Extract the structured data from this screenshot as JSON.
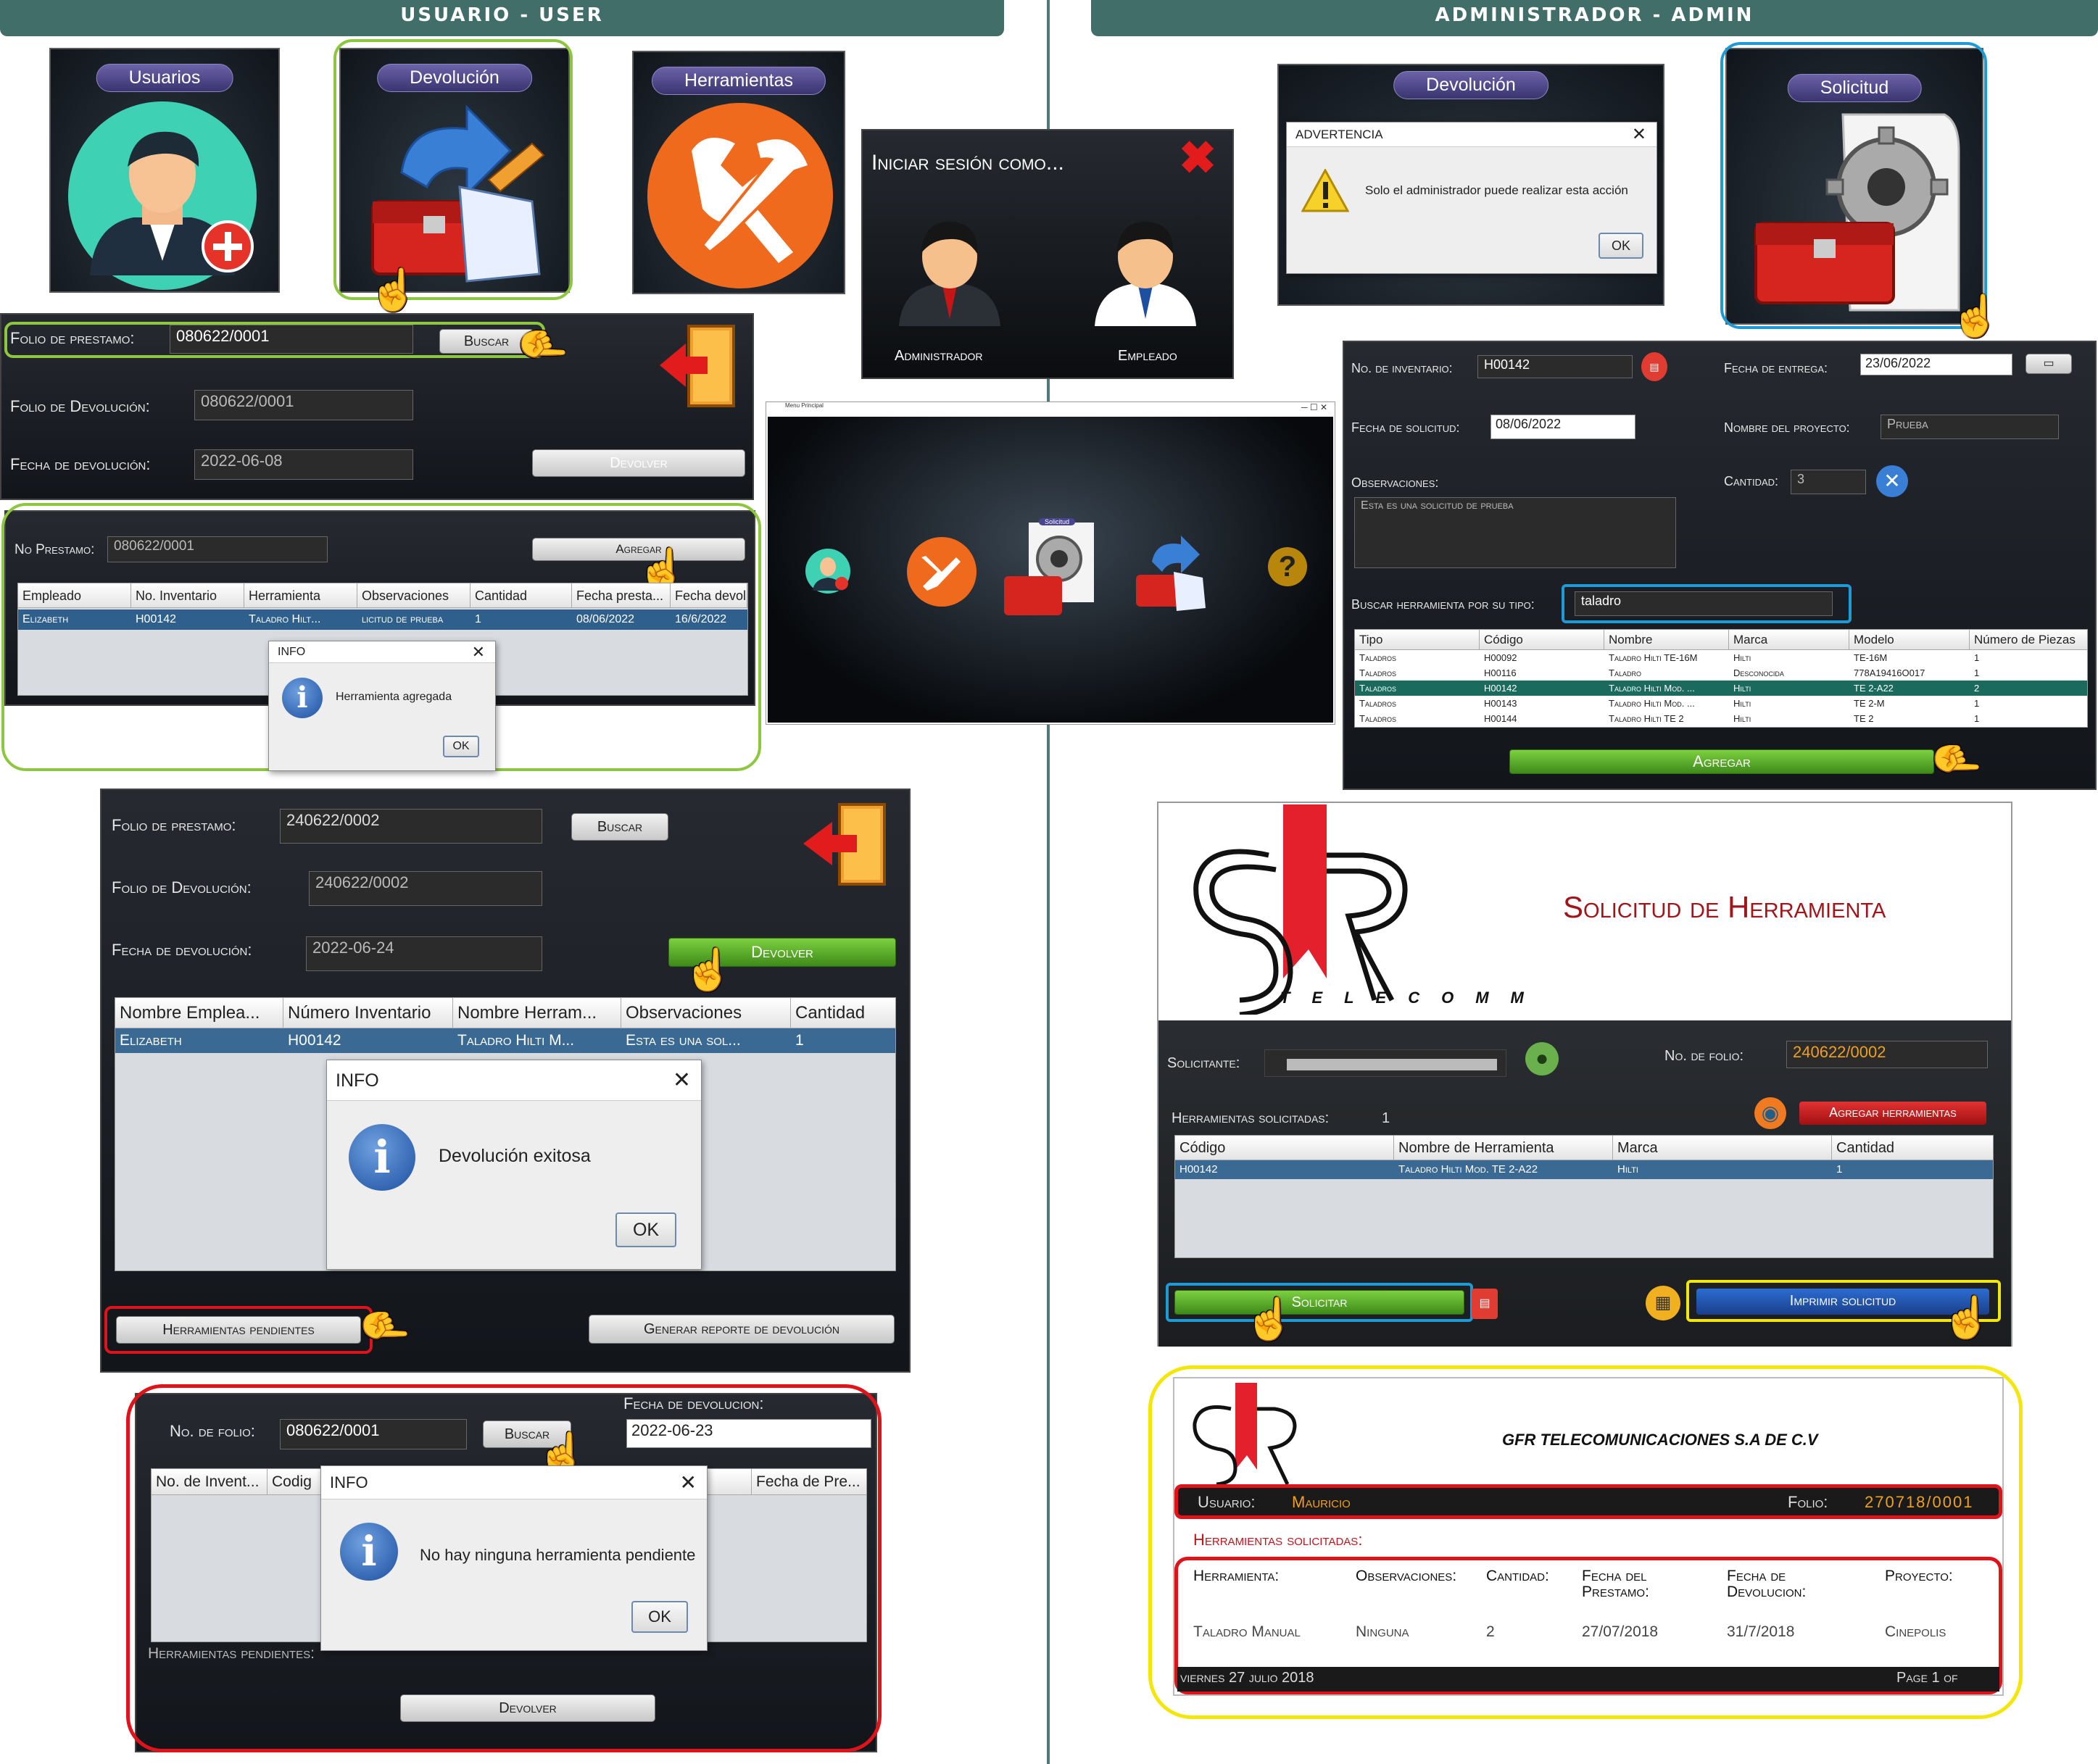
{
  "headers": {
    "user": "USUARIO - USER",
    "admin": "ADMINISTRADOR - ADMIN"
  },
  "icons": [
    "user-add-icon",
    "return-toolbox-icon",
    "tools-icon",
    "administrator-avatar-icon",
    "employee-avatar-icon",
    "request-gear-icon",
    "warning-icon",
    "info-icon",
    "exit-door-icon",
    "pointer-hand-icon",
    "pdf-icon",
    "search-icon",
    "help-icon"
  ],
  "menu_tiles": {
    "usuarios": "Usuarios",
    "devolucion": "Devolución",
    "herramientas": "Herramientas",
    "admin_devolucion": "Devolución",
    "solicitud": "Solicitud"
  },
  "login": {
    "title": "Iniciar sesión como...",
    "admin": "Administrador",
    "employee": "Empleado"
  },
  "warning_dialog": {
    "title": "ADVERTENCIA",
    "message": "Solo el administrador puede realizar esta acción",
    "ok": "OK"
  },
  "main_menu": {
    "title": "Menu Principal"
  },
  "return_form1": {
    "folio_prestamo_label": "Folio de prestamo:",
    "folio_prestamo": "080622/0001",
    "buscar": "Buscar",
    "folio_devolucion_label": "Folio de Devolución:",
    "folio_devolucion": "080622/0001",
    "fecha_label": "Fecha de devolución:",
    "fecha": "2022-06-08",
    "devolver": "Devolver"
  },
  "add_form": {
    "no_prestamo_label": "No Prestamo:",
    "no_prestamo": "080622/0001",
    "agregar": "Agregar",
    "columns": [
      "Empleado",
      "No. Inventario",
      "Herramienta",
      "Observaciones",
      "Cantidad",
      "Fecha presta...",
      "Fecha devolu..."
    ],
    "row": [
      "Elizabeth",
      "H00142",
      "Taladro Hilt...",
      "licitud de prueba",
      "1",
      "08/06/2022",
      "16/6/2022"
    ],
    "dialog": {
      "title": "INFO",
      "message": "Herramienta agregada",
      "ok": "OK"
    }
  },
  "return_form2": {
    "folio_prestamo_label": "Folio de prestamo:",
    "folio_prestamo": "240622/0002",
    "buscar": "Buscar",
    "folio_devolucion_label": "Folio de Devolución:",
    "folio_devolucion": "240622/0002",
    "fecha_label": "Fecha de devolución:",
    "fecha": "2022-06-24",
    "devolver": "Devolver",
    "columns": [
      "Nombre Emplea...",
      "Número Inventario",
      "Nombre Herram...",
      "Observaciones",
      "Cantidad"
    ],
    "row": [
      "Elizabeth",
      "H00142",
      "Taladro Hilti M...",
      "Esta es una sol...",
      "1"
    ],
    "dialog": {
      "title": "INFO",
      "message": "Devolución exitosa",
      "ok": "OK"
    },
    "pendientes": "Herramientas pendientes",
    "reporte": "Generar reporte de devolución"
  },
  "pending_form": {
    "folio_label": "No. de folio:",
    "folio": "080622/0001",
    "buscar": "Buscar",
    "fecha_label": "Fecha de devolucion:",
    "fecha": "2022-06-23",
    "columns": [
      "No. de Invent...",
      "Codig",
      "Fecha de Pre..."
    ],
    "dialog": {
      "title": "INFO",
      "message": "No hay ninguna herramienta pendiente",
      "ok": "OK"
    },
    "footer_label": "Herramientas pendientes:",
    "devolver": "Devolver"
  },
  "request_form": {
    "inventario_label": "No. de inventario:",
    "inventario": "H00142",
    "fecha_entrega_label": "Fecha de entrega:",
    "fecha_entrega": "23/06/2022",
    "fecha_solicitud_label": "Fecha de solicitud:",
    "fecha_solicitud": "08/06/2022",
    "proyecto_label": "Nombre del proyecto:",
    "proyecto": "Prueba",
    "observaciones_label": "Observaciones:",
    "observaciones": "Esta es una solicitud de prueba",
    "cantidad_label": "Cantidad:",
    "cantidad": "3",
    "buscar_label": "Buscar herramienta por su tipo:",
    "buscar": "taladro",
    "columns": [
      "Tipo",
      "Código",
      "Nombre",
      "Marca",
      "Modelo",
      "Número de Piezas"
    ],
    "rows": [
      [
        "Taladros",
        "H00092",
        "Taladro Hilti TE-16M",
        "Hilti",
        "TE-16M",
        "1"
      ],
      [
        "Taladros",
        "H00116",
        "Taladro",
        "Desconocida",
        "778A19416O017",
        "1"
      ],
      [
        "Taladros",
        "H00142",
        "Taladro Hilti Mod. ...",
        "Hilti",
        "TE 2-A22",
        "2"
      ],
      [
        "Taladros",
        "H00143",
        "Taladro Hilti Mod. ...",
        "Hilti",
        "TE 2-M",
        "1"
      ],
      [
        "Taladros",
        "H00144",
        "Taladro Hilti TE 2",
        "Hilti",
        "TE 2",
        "1"
      ]
    ],
    "agregar": "Agregar"
  },
  "solicitud": {
    "brand": "TELECOMM",
    "title": "Solicitud de Herramienta",
    "solicitante_label": "Solicitante:",
    "folio_label": "No. de folio:",
    "folio": "240622/0002",
    "solicitadas_label": "Herramientas solicitadas:",
    "solicitadas_count": "1",
    "agregar": "Agregar herramientas",
    "columns": [
      "Código",
      "Nombre de Herramienta",
      "Marca",
      "Cantidad"
    ],
    "row": [
      "H00142",
      "Taladro Hilti Mod. TE 2-A22",
      "Hilti",
      "1"
    ],
    "solicitar": "Solicitar",
    "imprimir": "Imprimir solicitud"
  },
  "report": {
    "company": "GFR TELECOMUNICACIONES S.A DE C.V",
    "usuario_label": "Usuario:",
    "usuario": "Mauricio",
    "folio_label": "Folio:",
    "folio": "270718/0001",
    "section": "Herramientas solicitadas:",
    "columns": [
      "Herramienta:",
      "Observaciones:",
      "Cantidad:",
      "Fecha del Prestamo:",
      "Fecha de Devolucion:",
      "Proyecto:"
    ],
    "row": [
      "Taladro Manual",
      "Ninguna",
      "2",
      "27/07/2018",
      "31/7/2018",
      "Cinepolis"
    ],
    "footer_date": "viernes 27 julio 2018",
    "footer_page": "Page 1 of"
  },
  "colors": {
    "header": "#426e6a",
    "green_outline": "#8dc63f",
    "blue_outline": "#1e9bd7",
    "red_outline": "#e0121a",
    "yellow_outline": "#f5e60a"
  }
}
